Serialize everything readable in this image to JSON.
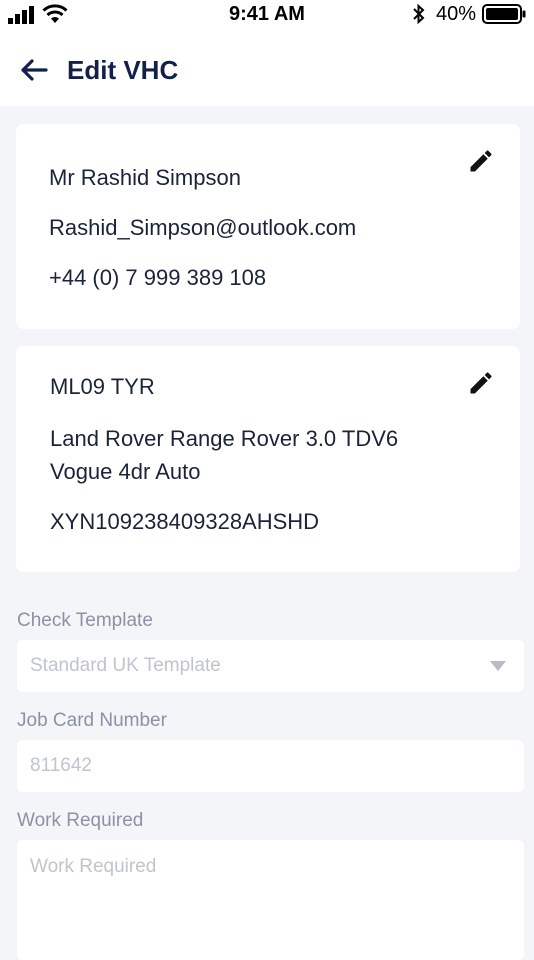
{
  "status_bar": {
    "time": "9:41 AM",
    "battery_percent": "40%",
    "icons": [
      "signal-icon",
      "wifi-icon",
      "bluetooth-icon",
      "battery-icon"
    ]
  },
  "header": {
    "title": "Edit VHC",
    "back_icon": "arrow-left-icon"
  },
  "customer": {
    "name": "Mr Rashid Simpson",
    "email": "Rashid_Simpson@outlook.com",
    "phone": "+44 (0) 7 999 389 108",
    "edit_icon": "pencil-icon"
  },
  "vehicle": {
    "registration": "ML09 TYR",
    "model_line1": "Land Rover Range Rover 3.0 TDV6",
    "model_line2": "Vogue 4dr Auto",
    "vin": "XYN109238409328AHSHD",
    "edit_icon": "pencil-icon"
  },
  "form": {
    "check_template": {
      "label": "Check Template",
      "value": "Standard UK Template"
    },
    "job_card": {
      "label": "Job Card Number",
      "placeholder": "811642"
    },
    "work_required": {
      "label": "Work Required",
      "placeholder": "Work Required"
    }
  },
  "colors": {
    "title": "#13204a",
    "text": "#1b2338",
    "label": "#8a92a3",
    "placeholder": "#c0c4cd",
    "background": "#f4f5f8"
  }
}
